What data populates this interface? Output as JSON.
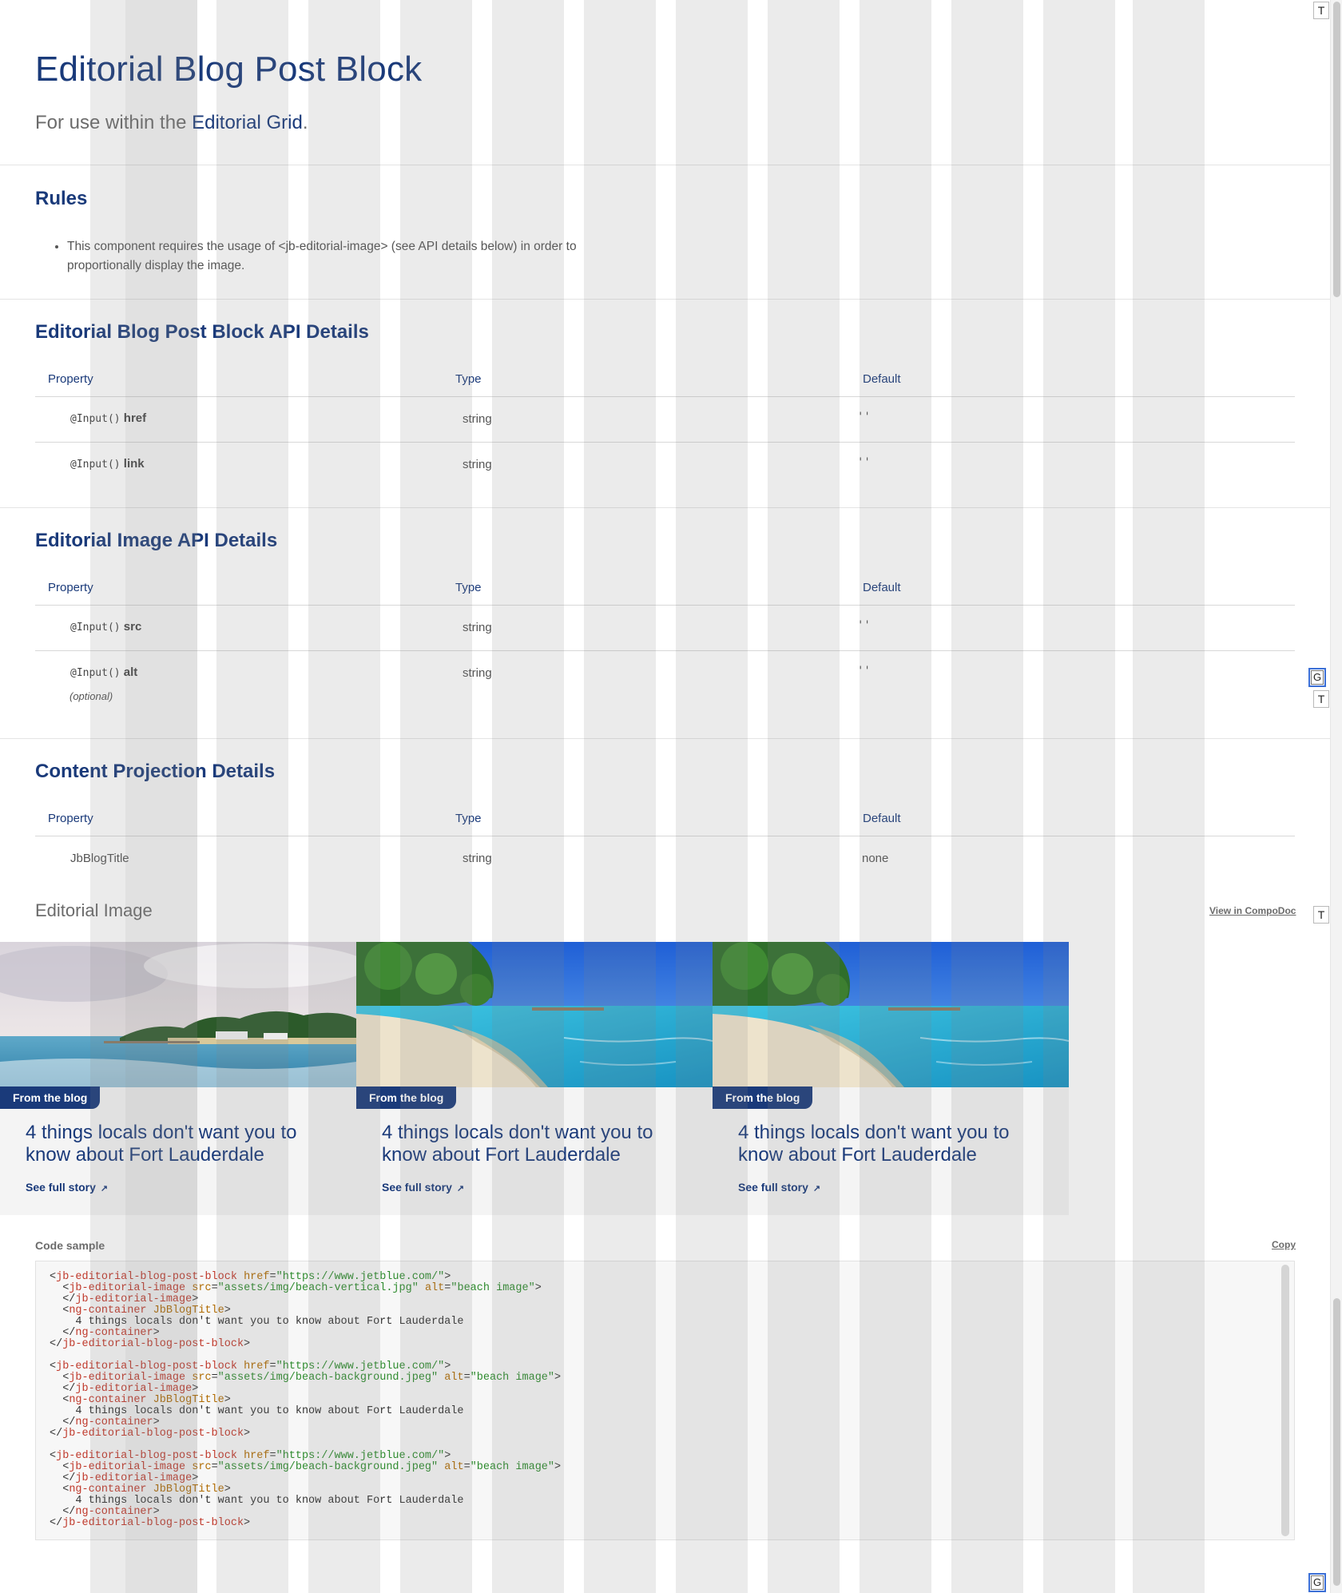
{
  "header": {
    "title": "Editorial Blog Post Block",
    "subtitle_prefix": "For use within the ",
    "subtitle_link": "Editorial Grid",
    "subtitle_suffix": "."
  },
  "rules": {
    "title": "Rules",
    "items": [
      "This component requires the usage of <jb-editorial-image> (see API details below) in order to proportionally display the image."
    ]
  },
  "tables": [
    {
      "title": "Editorial Blog Post Block API Details",
      "headers": [
        "Property",
        "Type",
        "Default"
      ],
      "rows": [
        {
          "decorator": "@Input()",
          "name": "href",
          "type": "string",
          "default": "''"
        },
        {
          "decorator": "@Input()",
          "name": "link",
          "type": "string",
          "default": "''"
        }
      ]
    },
    {
      "title": "Editorial Image API Details",
      "headers": [
        "Property",
        "Type",
        "Default"
      ],
      "rows": [
        {
          "decorator": "@Input()",
          "name": "src",
          "type": "string",
          "default": "''"
        },
        {
          "decorator": "@Input()",
          "name": "alt",
          "type": "string",
          "default": "''",
          "note": "(optional)"
        }
      ]
    },
    {
      "title": "Content Projection Details",
      "headers": [
        "Property",
        "Type",
        "Default"
      ],
      "rows": [
        {
          "name": "JbBlogTitle",
          "type": "string",
          "default": "none"
        }
      ]
    }
  ],
  "example": {
    "label": "Editorial Image",
    "compodoc_link": "View in CompoDoc",
    "cards": [
      {
        "badge": "From the blog",
        "title": "4 things locals don't want you to know about Fort Lauderdale",
        "link": "See full story",
        "image": "beach-vertical"
      },
      {
        "badge": "From the blog",
        "title": "4 things locals don't want you to know about Fort Lauderdale",
        "link": "See full story",
        "image": "beach-background"
      },
      {
        "badge": "From the blog",
        "title": "4 things locals don't want you to know about Fort Lauderdale",
        "link": "See full story",
        "image": "beach-background"
      }
    ]
  },
  "code_sample": {
    "label": "Code sample",
    "copy_label": "Copy",
    "blocks": [
      {
        "href": "https://www.jetblue.com/",
        "src": "assets/img/beach-vertical.jpg",
        "alt": "beach image",
        "text": "4 things locals don't want you to know about Fort Lauderdale"
      },
      {
        "href": "https://www.jetblue.com/",
        "src": "assets/img/beach-background.jpeg",
        "alt": "beach image",
        "text": "4 things locals don't want you to know about Fort Lauderdale"
      },
      {
        "href": "https://www.jetblue.com/",
        "src": "assets/img/beach-background.jpeg",
        "alt": "beach image",
        "text": "4 things locals don't want you to know about Fort Lauderdale"
      }
    ]
  },
  "toolbar": {
    "t_label": "T",
    "g_label": "G"
  },
  "colors": {
    "brand_navy": "#1a3a7a",
    "badge_bg": "#1a3a7a",
    "grid_overlay": "#808080"
  }
}
